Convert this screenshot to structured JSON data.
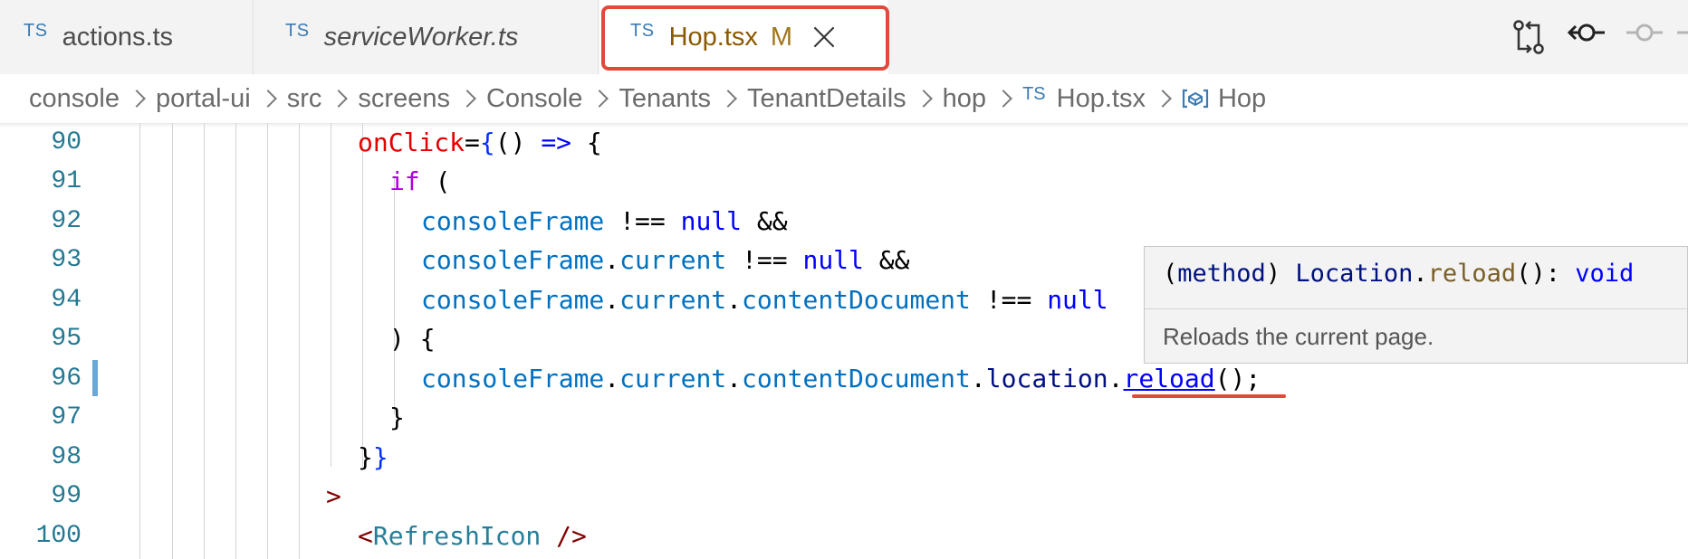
{
  "tabs": [
    {
      "type_badge": "TS",
      "label": "actions.ts"
    },
    {
      "type_badge": "TS",
      "label": "serviceWorker.ts"
    },
    {
      "type_badge": "TS",
      "label": "Hop.tsx",
      "modified_marker": "M"
    }
  ],
  "toolbar_icons": [
    "git-compare-icon",
    "git-commit-icon",
    "git-commit-faded-icon"
  ],
  "breadcrumb": {
    "items": [
      "console",
      "portal-ui",
      "src",
      "screens",
      "Console",
      "Tenants",
      "TenantDetails",
      "hop"
    ],
    "file": {
      "type_badge": "TS",
      "label": "Hop.tsx"
    },
    "symbol": {
      "icon": "symbol-variable-icon",
      "label": "Hop"
    }
  },
  "line_numbers": [
    "90",
    "91",
    "92",
    "93",
    "94",
    "95",
    "96",
    "97",
    "98",
    "99",
    "100"
  ],
  "code": {
    "l90": {
      "attr": "onClick",
      "eq": "=",
      "brace": "{",
      "paren": "()",
      "arrow": "=>",
      "open": "{"
    },
    "l91": {
      "kw": "if",
      "paren": "("
    },
    "l92": {
      "var": "consoleFrame",
      "op": "!==",
      "null": "null",
      "and": "&&"
    },
    "l93": {
      "var": "consoleFrame",
      "dot": ".",
      "prop": "current",
      "op": "!==",
      "null": "null",
      "and": "&&"
    },
    "l94": {
      "var": "consoleFrame",
      "dot1": ".",
      "prop1": "current",
      "dot2": ".",
      "prop2": "contentDocument",
      "op": "!==",
      "null": "null"
    },
    "l95": {
      "text": ") {"
    },
    "l96": {
      "var": "consoleFrame",
      "dot1": ".",
      "prop1": "current",
      "dot2": ".",
      "prop2": "contentDocument",
      "dot3": ".",
      "prop3": "location",
      "dot4": ".",
      "method": "reload",
      "call": "();"
    },
    "l97": {
      "text": "}"
    },
    "l98": {
      "close1": "}",
      "close2": "}"
    },
    "l99": {
      "gt": ">"
    },
    "l100": {
      "lt": "<",
      "comp": "RefreshIcon",
      "end": " />"
    }
  },
  "hover": {
    "open": "(",
    "kind": "method",
    "close": ")",
    "owner": "Location",
    "dot": ".",
    "name": "reload",
    "call": "():",
    "ret": "void",
    "doc": "Reloads the current page."
  },
  "colors": {
    "highlight": "#e04a3a",
    "line_number": "#237893",
    "modified_gutter": "#69a8d6"
  }
}
